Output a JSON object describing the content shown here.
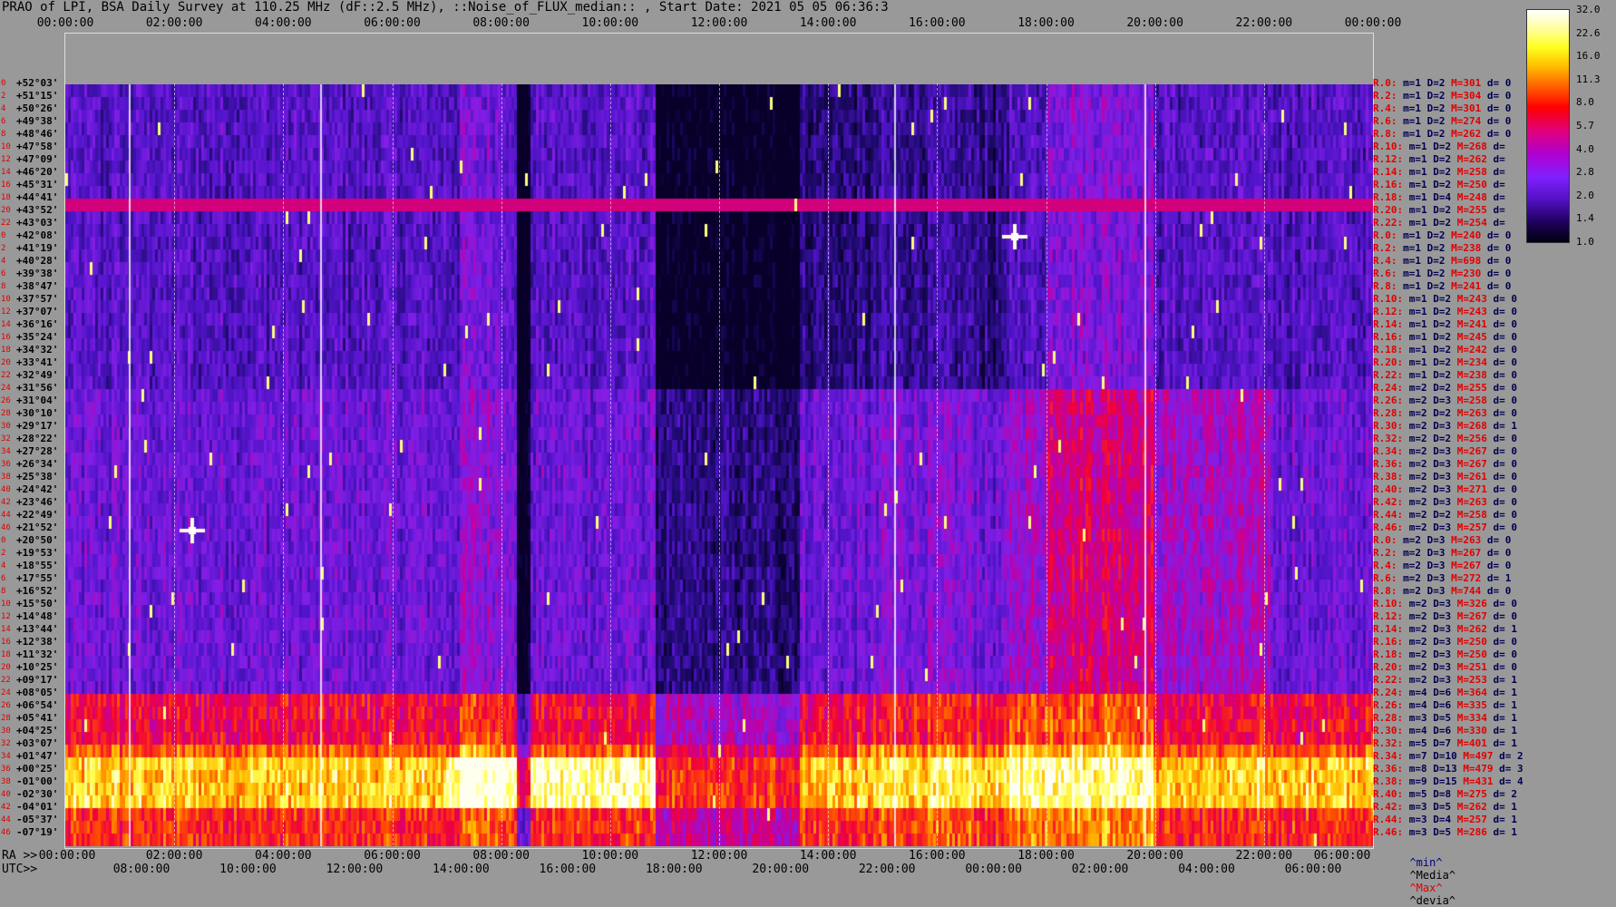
{
  "title": "PRAO of LPI, BSA Daily Survey at 110.25 MHz (dF::2.5 MHz), ::Noise_of_FLUX_median:: , Start Date: 2021 05 05 06:36:3",
  "top_axis_ticks": [
    "00:00:00",
    "02:00:00",
    "04:00:00",
    "06:00:00",
    "08:00:00",
    "10:00:00",
    "12:00:00",
    "14:00:00",
    "16:00:00",
    "18:00:00",
    "20:00:00",
    "22:00:00",
    "00:00:00"
  ],
  "bottom_axis": {
    "ra_caption": "RA >>",
    "ra_ticks": [
      "00:00:00",
      "02:00:00",
      "04:00:00",
      "06:00:00",
      "08:00:00",
      "10:00:00",
      "12:00:00",
      "14:00:00",
      "16:00:00",
      "18:00:00",
      "20:00:00",
      "22:00:00",
      "06:00:00"
    ],
    "utc_caption": "UTC>>",
    "utc_ticks": [
      "08:00:00",
      "10:00:00",
      "12:00:00",
      "14:00:00",
      "16:00:00",
      "18:00:00",
      "20:00:00",
      "22:00:00",
      "00:00:00",
      "02:00:00",
      "04:00:00",
      "06:00:00"
    ]
  },
  "colorbar": {
    "labels": [
      "32.0",
      "22.6",
      "16.0",
      "11.3",
      "8.0",
      "5.7",
      "4.0",
      "2.8",
      "2.0",
      "1.4",
      "1.0"
    ]
  },
  "legend_footer": {
    "min": "^min^",
    "media": "^Media^",
    "max": "^Max^",
    "devia": "^devia^"
  },
  "chart_data": {
    "type": "heatmap",
    "title": "PRAO of LPI, BSA Daily Survey at 110.25 MHz (dF::2.5 MHz), ::Noise_of_FLUX_median:: , Start Date: 2021 05 05 06:36:3",
    "x_axis": "RA 00:00:00 – 24:00:00",
    "colorscale_range": [
      1.0,
      32.0
    ],
    "declinations": [
      "+52°03'",
      "+51°15'",
      "+50°26'",
      "+49°38'",
      "+48°46'",
      "+47°58'",
      "+47°09'",
      "+46°20'",
      "+45°31'",
      "+44°41'",
      "+43°52'",
      "+43°03'",
      "+42°08'",
      "+41°19'",
      "+40°28'",
      "+39°38'",
      "+38°47'",
      "+37°57'",
      "+37°07'",
      "+36°16'",
      "+35°24'",
      "+34°32'",
      "+33°41'",
      "+32°49'",
      "+31°56'",
      "+31°04'",
      "+30°10'",
      "+29°17'",
      "+28°22'",
      "+27°28'",
      "+26°34'",
      "+25°38'",
      "+24°42'",
      "+23°46'",
      "+22°49'",
      "+21°52'",
      "+20°50'",
      "+19°53'",
      "+18°55'",
      "+17°55'",
      "+16°52'",
      "+15°50'",
      "+14°48'",
      "+13°44'",
      "+12°38'",
      "+11°32'",
      "+10°25'",
      "+09°17'",
      "+08°05'",
      "+06°54'",
      "+05°41'",
      "+04°25'",
      "+03°07'",
      "+01°47'",
      "+00°25'",
      "-01°00'",
      "-02°30'",
      "-04°01'",
      "-05°37'",
      "-07°19'"
    ],
    "row_index_labels": [
      "0",
      "2",
      "4",
      "6",
      "8",
      "10",
      "12",
      "14",
      "16",
      "18",
      "20",
      "22",
      "0",
      "2",
      "4",
      "6",
      "8",
      "10",
      "12",
      "14",
      "16",
      "18",
      "20",
      "22",
      "24",
      "26",
      "28",
      "30",
      "32",
      "34",
      "36",
      "38",
      "40",
      "42",
      "44",
      "46",
      "0",
      "2",
      "4",
      "6",
      "8",
      "10",
      "12",
      "14",
      "16",
      "18",
      "20",
      "22",
      "24",
      "26",
      "28",
      "30",
      "32",
      "34",
      "36",
      "38",
      "40",
      "42",
      "44",
      "46"
    ],
    "beam_stats": [
      {
        "r": "R.0:",
        "m": "1",
        "D": "2",
        "M": "301",
        "d": "0"
      },
      {
        "r": "R.2:",
        "m": "1",
        "D": "2",
        "M": "304",
        "d": "0"
      },
      {
        "r": "R.4:",
        "m": "1",
        "D": "2",
        "M": "301",
        "d": "0"
      },
      {
        "r": "R.6:",
        "m": "1",
        "D": "2",
        "M": "274",
        "d": "0"
      },
      {
        "r": "R.8:",
        "m": "1",
        "D": "2",
        "M": "262",
        "d": "0"
      },
      {
        "r": "R.10:",
        "m": "1",
        "D": "2",
        "M": "268",
        "d": ""
      },
      {
        "r": "R.12:",
        "m": "1",
        "D": "2",
        "M": "262",
        "d": ""
      },
      {
        "r": "R.14:",
        "m": "1",
        "D": "2",
        "M": "258",
        "d": ""
      },
      {
        "r": "R.16:",
        "m": "1",
        "D": "2",
        "M": "250",
        "d": ""
      },
      {
        "r": "R.18:",
        "m": "1",
        "D": "4",
        "M": "248",
        "d": ""
      },
      {
        "r": "R.20:",
        "m": "1",
        "D": "2",
        "M": "255",
        "d": ""
      },
      {
        "r": "R.22:",
        "m": "1",
        "D": "2",
        "M": "254",
        "d": ""
      },
      {
        "r": "R.0:",
        "m": "1",
        "D": "2",
        "M": "240",
        "d": "0"
      },
      {
        "r": "R.2:",
        "m": "1",
        "D": "2",
        "M": "238",
        "d": "0"
      },
      {
        "r": "R.4:",
        "m": "1",
        "D": "2",
        "M": "698",
        "d": "0"
      },
      {
        "r": "R.6:",
        "m": "1",
        "D": "2",
        "M": "230",
        "d": "0"
      },
      {
        "r": "R.8:",
        "m": "1",
        "D": "2",
        "M": "241",
        "d": "0"
      },
      {
        "r": "R.10:",
        "m": "1",
        "D": "2",
        "M": "243",
        "d": "0"
      },
      {
        "r": "R.12:",
        "m": "1",
        "D": "2",
        "M": "243",
        "d": "0"
      },
      {
        "r": "R.14:",
        "m": "1",
        "D": "2",
        "M": "241",
        "d": "0"
      },
      {
        "r": "R.16:",
        "m": "1",
        "D": "2",
        "M": "245",
        "d": "0"
      },
      {
        "r": "R.18:",
        "m": "1",
        "D": "2",
        "M": "242",
        "d": "0"
      },
      {
        "r": "R.20:",
        "m": "1",
        "D": "2",
        "M": "234",
        "d": "0"
      },
      {
        "r": "R.22:",
        "m": "1",
        "D": "2",
        "M": "238",
        "d": "0"
      },
      {
        "r": "R.24:",
        "m": "2",
        "D": "2",
        "M": "255",
        "d": "0"
      },
      {
        "r": "R.26:",
        "m": "2",
        "D": "3",
        "M": "258",
        "d": "0"
      },
      {
        "r": "R.28:",
        "m": "2",
        "D": "2",
        "M": "263",
        "d": "0"
      },
      {
        "r": "R.30:",
        "m": "2",
        "D": "3",
        "M": "268",
        "d": "1"
      },
      {
        "r": "R.32:",
        "m": "2",
        "D": "2",
        "M": "256",
        "d": "0"
      },
      {
        "r": "R.34:",
        "m": "2",
        "D": "3",
        "M": "267",
        "d": "0"
      },
      {
        "r": "R.36:",
        "m": "2",
        "D": "3",
        "M": "267",
        "d": "0"
      },
      {
        "r": "R.38:",
        "m": "2",
        "D": "3",
        "M": "261",
        "d": "0"
      },
      {
        "r": "R.40:",
        "m": "2",
        "D": "3",
        "M": "271",
        "d": "0"
      },
      {
        "r": "R.42:",
        "m": "2",
        "D": "3",
        "M": "263",
        "d": "0"
      },
      {
        "r": "R.44:",
        "m": "2",
        "D": "2",
        "M": "258",
        "d": "0"
      },
      {
        "r": "R.46:",
        "m": "2",
        "D": "3",
        "M": "257",
        "d": "0"
      },
      {
        "r": "R.0:",
        "m": "2",
        "D": "3",
        "M": "263",
        "d": "0"
      },
      {
        "r": "R.2:",
        "m": "2",
        "D": "3",
        "M": "267",
        "d": "0"
      },
      {
        "r": "R.4:",
        "m": "2",
        "D": "3",
        "M": "267",
        "d": "0"
      },
      {
        "r": "R.6:",
        "m": "2",
        "D": "3",
        "M": "272",
        "d": "1"
      },
      {
        "r": "R.8:",
        "m": "2",
        "D": "3",
        "M": "744",
        "d": "0"
      },
      {
        "r": "R.10:",
        "m": "2",
        "D": "3",
        "M": "326",
        "d": "0"
      },
      {
        "r": "R.12:",
        "m": "2",
        "D": "3",
        "M": "267",
        "d": "0"
      },
      {
        "r": "R.14:",
        "m": "2",
        "D": "3",
        "M": "262",
        "d": "1"
      },
      {
        "r": "R.16:",
        "m": "2",
        "D": "3",
        "M": "250",
        "d": "0"
      },
      {
        "r": "R.18:",
        "m": "2",
        "D": "3",
        "M": "250",
        "d": "0"
      },
      {
        "r": "R.20:",
        "m": "2",
        "D": "3",
        "M": "251",
        "d": "0"
      },
      {
        "r": "R.22:",
        "m": "2",
        "D": "3",
        "M": "253",
        "d": "1"
      },
      {
        "r": "R.24:",
        "m": "4",
        "D": "6",
        "M": "364",
        "d": "1"
      },
      {
        "r": "R.26:",
        "m": "4",
        "D": "6",
        "M": "335",
        "d": "1"
      },
      {
        "r": "R.28:",
        "m": "3",
        "D": "5",
        "M": "334",
        "d": "1"
      },
      {
        "r": "R.30:",
        "m": "4",
        "D": "6",
        "M": "330",
        "d": "1"
      },
      {
        "r": "R.32:",
        "m": "5",
        "D": "7",
        "M": "401",
        "d": "1"
      },
      {
        "r": "R.34:",
        "m": "7",
        "D": "10",
        "M": "497",
        "d": "2"
      },
      {
        "r": "R.36:",
        "m": "8",
        "D": "13",
        "M": "479",
        "d": "3"
      },
      {
        "r": "R.38:",
        "m": "9",
        "D": "15",
        "M": "431",
        "d": "4"
      },
      {
        "r": "R.40:",
        "m": "5",
        "D": "8",
        "M": "275",
        "d": "2"
      },
      {
        "r": "R.42:",
        "m": "3",
        "D": "5",
        "M": "262",
        "d": "1"
      },
      {
        "r": "R.44:",
        "m": "3",
        "D": "4",
        "M": "257",
        "d": "1"
      },
      {
        "r": "R.46:",
        "m": "3",
        "D": "5",
        "M": "286",
        "d": "1"
      }
    ]
  }
}
